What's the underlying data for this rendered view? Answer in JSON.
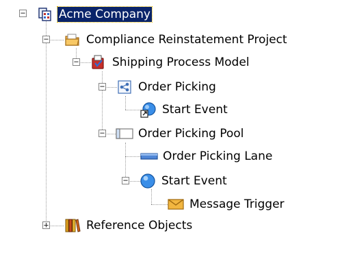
{
  "tree": {
    "nodes": [
      {
        "label": "Acme Company",
        "icon": "company-icon",
        "toggle": "minus",
        "selected": true
      },
      {
        "label": "Compliance Reinstatement Project",
        "icon": "folder-icon",
        "toggle": "minus"
      },
      {
        "label": "Shipping Process Model",
        "icon": "process-model-icon",
        "toggle": "minus"
      },
      {
        "label": "Order Picking",
        "icon": "diagram-icon",
        "toggle": "minus"
      },
      {
        "label": "Start Event",
        "icon": "start-event-link-icon",
        "toggle": null
      },
      {
        "label": "Order Picking Pool",
        "icon": "pool-icon",
        "toggle": "minus"
      },
      {
        "label": "Order Picking Lane",
        "icon": "lane-icon",
        "toggle": null
      },
      {
        "label": "Start Event",
        "icon": "start-event-icon",
        "toggle": "minus"
      },
      {
        "label": "Message Trigger",
        "icon": "envelope-icon",
        "toggle": null
      },
      {
        "label": "Reference Objects",
        "icon": "books-icon",
        "toggle": "plus"
      }
    ],
    "toggle_glyphs": {
      "minus": "−",
      "plus": "+"
    }
  },
  "colors": {
    "selection_bg": "#0a246a",
    "selection_fg": "#ffffff",
    "tree_line": "#9a9a9a"
  }
}
